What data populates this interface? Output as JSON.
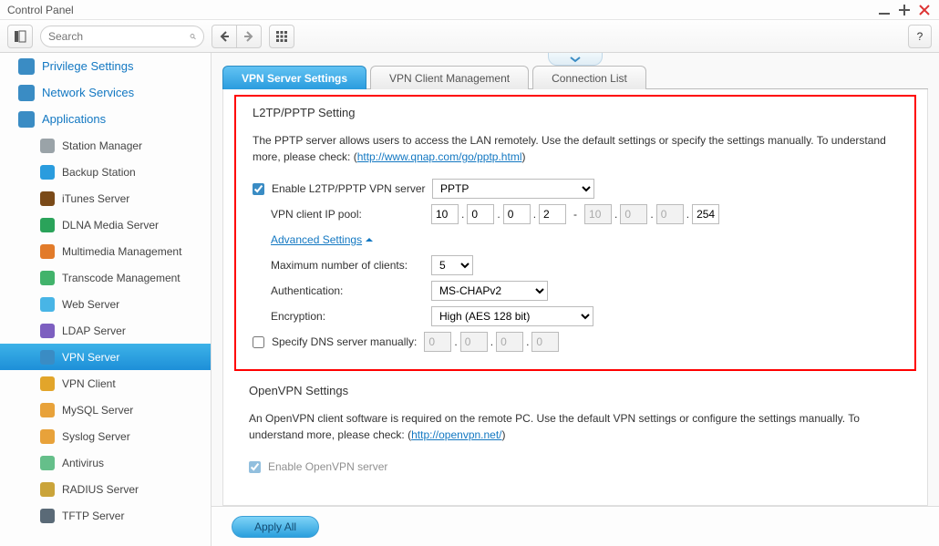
{
  "window": {
    "title": "Control Panel"
  },
  "toolbar": {
    "search_placeholder": "Search",
    "back_label": "←",
    "forward_label": "→",
    "help_label": "?"
  },
  "sidebar": {
    "top": [
      {
        "label": "Privilege Settings",
        "icon": "#3a8cc4"
      },
      {
        "label": "Network Services",
        "icon": "#3a8cc4"
      },
      {
        "label": "Applications",
        "icon": "#3a8cc4"
      }
    ],
    "subs": [
      {
        "label": "Station Manager",
        "icon": "#9aa3a8"
      },
      {
        "label": "Backup Station",
        "icon": "#2a9cde"
      },
      {
        "label": "iTunes Server",
        "icon": "#7a4a18"
      },
      {
        "label": "DLNA Media Server",
        "icon": "#2aa35a"
      },
      {
        "label": "Multimedia Management",
        "icon": "#e27b2a"
      },
      {
        "label": "Transcode Management",
        "icon": "#42b36b"
      },
      {
        "label": "Web Server",
        "icon": "#48b5e6"
      },
      {
        "label": "LDAP Server",
        "icon": "#7d5fc0"
      },
      {
        "label": "VPN Server",
        "icon": "#3a8cc4",
        "active": true
      },
      {
        "label": "VPN Client",
        "icon": "#e2a52a"
      },
      {
        "label": "MySQL Server",
        "icon": "#e8a23a"
      },
      {
        "label": "Syslog Server",
        "icon": "#e8a23a"
      },
      {
        "label": "Antivirus",
        "icon": "#65bf8a"
      },
      {
        "label": "RADIUS Server",
        "icon": "#caa43a"
      },
      {
        "label": "TFTP Server",
        "icon": "#5a6a77"
      }
    ]
  },
  "tabs": [
    {
      "label": "VPN Server Settings",
      "active": true
    },
    {
      "label": "VPN Client Management"
    },
    {
      "label": "Connection List"
    }
  ],
  "l2tp": {
    "section": "L2TP/PPTP Setting",
    "desc_pre": "The PPTP server allows users to access the LAN remotely. Use the default settings or specify the settings manually. To understand more, please check: (",
    "desc_link": "http://www.qnap.com/go/pptp.html",
    "desc_post": ")",
    "enable_label": "Enable L2TP/PPTP VPN server",
    "proto_selected": "PPTP",
    "pool_label": "VPN client IP pool:",
    "pool_start": [
      "10",
      "0",
      "0",
      "2"
    ],
    "pool_end": [
      "10",
      "0",
      "0",
      "254"
    ],
    "adv_link": "Advanced Settings",
    "max_label": "Maximum number of clients:",
    "max_value": "5",
    "auth_label": "Authentication:",
    "auth_value": "MS-CHAPv2",
    "enc_label": "Encryption:",
    "enc_value": "High (AES 128 bit)",
    "dns_label": "Specify DNS server manually:",
    "dns": [
      "0",
      "0",
      "0",
      "0"
    ]
  },
  "openvpn": {
    "section": "OpenVPN Settings",
    "desc_pre": "An OpenVPN client software is required on the remote PC. Use the default VPN settings or configure the settings manually. To understand more, please check: (",
    "desc_link": "http://openvpn.net/",
    "desc_post": ")",
    "enable_label": "Enable OpenVPN server"
  },
  "footer": {
    "apply": "Apply All"
  }
}
